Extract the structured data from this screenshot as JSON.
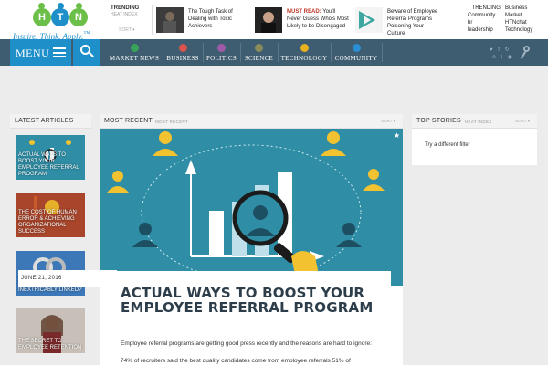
{
  "logo": {
    "letters": [
      "H",
      "T",
      "N"
    ],
    "tagline": "Inspire. Think. Apply.",
    "tm": "™"
  },
  "trending": {
    "label": "TRENDING",
    "sub": "HEAT INDEX",
    "sort": "SORT ▾"
  },
  "teasers": [
    {
      "prefix": "",
      "text": "The Tough Task of Dealing with Toxic Achievers"
    },
    {
      "prefix": "MUST READ:",
      "text": "You'll Never Guess Who's Most Likely to be Disengaged"
    },
    {
      "prefix": "",
      "text": "Beware of Employee Referral Programs Poisoning Your Culture"
    }
  ],
  "trend_right": {
    "col1": [
      "↑ TRENDING",
      "Community",
      "hr",
      "leadership"
    ],
    "col2": [
      "Business",
      "Market",
      "HTNchat",
      "Technology"
    ]
  },
  "nav": {
    "menu_label": "MENU",
    "items": [
      {
        "label": "MARKET NEWS",
        "color": "#3aa35a"
      },
      {
        "label": "BUSINESS",
        "color": "#d9534f"
      },
      {
        "label": "POLITICS",
        "color": "#a05aa8"
      },
      {
        "label": "SCIENCE",
        "color": "#8c8c5a"
      },
      {
        "label": "TECHNOLOGY",
        "color": "#e8b21e"
      },
      {
        "label": "COMMUNITY",
        "color": "#2a8fd4"
      }
    ],
    "social_row1": "♥ f ↻",
    "social_row2": "in t ◉"
  },
  "latest": {
    "title": "LATEST ARTICLES",
    "articles": [
      {
        "caption": "ACTUAL WAYS TO BOOST YOUR EMPLOYEE REFERRAL PROGRAM",
        "color": "#2f8ea6"
      },
      {
        "caption": "THE COST OF HUMAN ERROR & ACHIEVING ORGANIZATIONAL SUCCESS",
        "color": "#a8452b"
      },
      {
        "caption": "ARE ONBOARDING AND PROFITABILITY INEXTRICABLY LINKED?",
        "color": "#3c78b8"
      },
      {
        "caption": "THE SECRET TO EMPLOYEE RETENTION",
        "color": "#c8c0b8"
      }
    ]
  },
  "recent": {
    "title": "MOST RECENT",
    "sub": "MOST RECENT",
    "sort": "SORT ▾",
    "date": "JUNE 21, 2016",
    "headline": "ACTUAL WAYS TO BOOST YOUR EMPLOYEE REFERRAL PROGRAM",
    "body1": "Employee referral programs are getting good press recently and the reasons are hard to ignore:",
    "body2": "74% of recruiters said the best quality candidates come from employee referrals 51% of"
  },
  "stories": {
    "title": "TOP STORIES",
    "sub": "HEAT INDEX",
    "sort": "SORT ▾",
    "empty": "Try a different filter"
  }
}
